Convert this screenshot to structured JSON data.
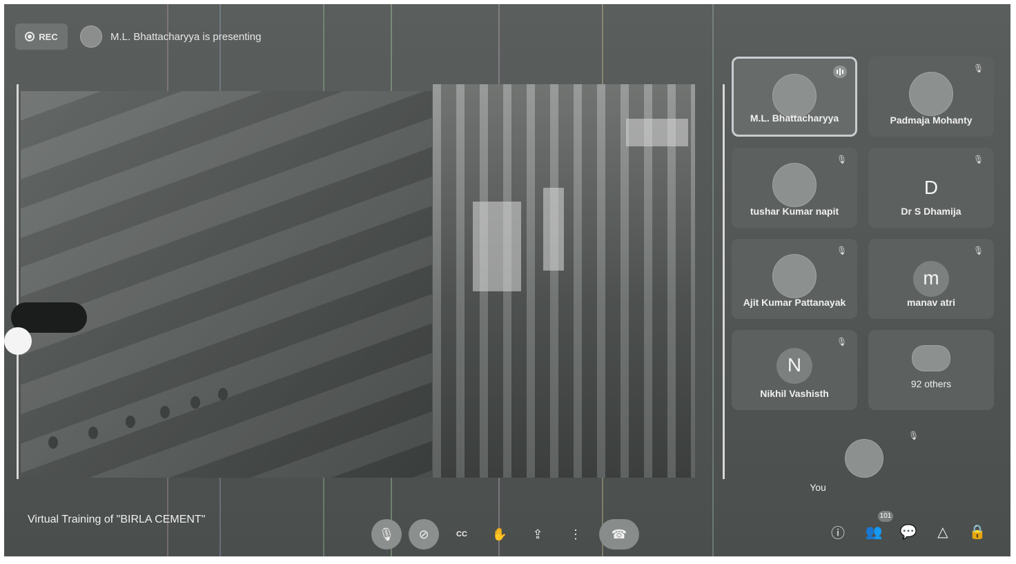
{
  "recording": {
    "label": "REC"
  },
  "presenter": {
    "text": "M.L. Bhattacharyya is presenting"
  },
  "participants": [
    {
      "name": "M.L. Bhattacharyya",
      "type": "photo",
      "speaking": true
    },
    {
      "name": "Padmaja Mohanty",
      "type": "photo",
      "muted": true
    },
    {
      "name": "tushar Kumar napit",
      "type": "photo",
      "muted": true
    },
    {
      "name": "Dr S Dhamija",
      "type": "letter",
      "letter": "D",
      "muted": true
    },
    {
      "name": "Ajit Kumar Pattanayak",
      "type": "photo",
      "muted": true
    },
    {
      "name": "manav atri",
      "type": "letter",
      "letter": "m",
      "muted": true
    },
    {
      "name": "Nikhil Vashisth",
      "type": "letter",
      "letter": "N",
      "muted": true
    },
    {
      "name": "92 others",
      "type": "group"
    },
    {
      "name": "You",
      "type": "photo",
      "muted": true
    }
  ],
  "meeting": {
    "title": "Virtual Training of \"BIRLA CEMENT\""
  },
  "controls": [
    {
      "name": "mic-off-icon",
      "glyph": "🎙"
    },
    {
      "name": "camera-off-icon",
      "glyph": "⊘"
    },
    {
      "name": "captions-icon",
      "glyph": "CC"
    },
    {
      "name": "raise-hand-icon",
      "glyph": "✋"
    },
    {
      "name": "present-screen-icon",
      "glyph": "⇪"
    },
    {
      "name": "more-options-icon",
      "glyph": "⋮"
    },
    {
      "name": "leave-call-icon",
      "glyph": "☎"
    }
  ],
  "side_controls": {
    "info": "ⓘ",
    "people": "👥",
    "people_count": "101",
    "chat": "💬",
    "activities": "△",
    "host_controls": "🔒"
  },
  "colors": {
    "background": "#4f5351",
    "tile": "#5c605e",
    "text": "#f1f1f1"
  }
}
